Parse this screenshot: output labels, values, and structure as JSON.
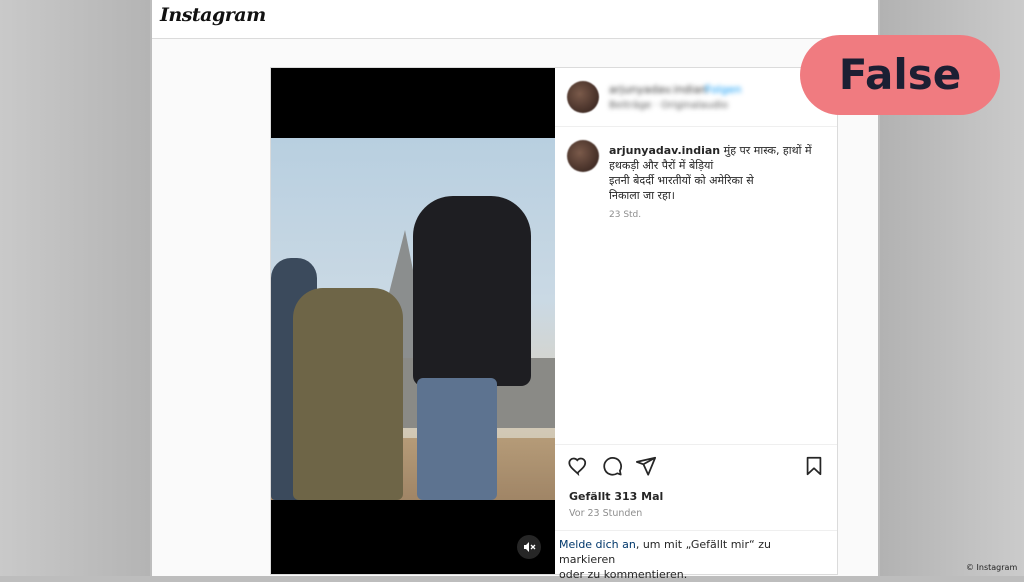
{
  "app": {
    "logo": "Instagram"
  },
  "post": {
    "header": {
      "username": "arjunyadav.indian",
      "follow_label": "Folgen",
      "subtitle": "Beiträge · Originalaudio"
    },
    "caption": {
      "username": "arjunyadav.indian",
      "text_line1": "मुंह पर मास्क, हाथों में",
      "text_line2": "हथकड़ी और पैरों में बेड़ियां",
      "text_line3": "इतनी बेदर्दी भारतीयों को अमेरिका से",
      "text_line4": "निकाला जा रहा।",
      "time": "23 Std."
    },
    "likes": "Gefällt 313 Mal",
    "time_ago": "Vor 23 Stunden",
    "login_prompt": {
      "link": "Melde dich an",
      "text_line1": ", um mit „Gefällt mir“ zu markieren",
      "text_line2": "oder zu kommentieren."
    },
    "icons": {
      "like": "heart-icon",
      "comment": "comment-icon",
      "share": "share-icon",
      "save": "bookmark-icon",
      "mute": "mute-icon"
    }
  },
  "badge": {
    "label": "False",
    "color": "#f07b80"
  },
  "credit": "© Instagram"
}
